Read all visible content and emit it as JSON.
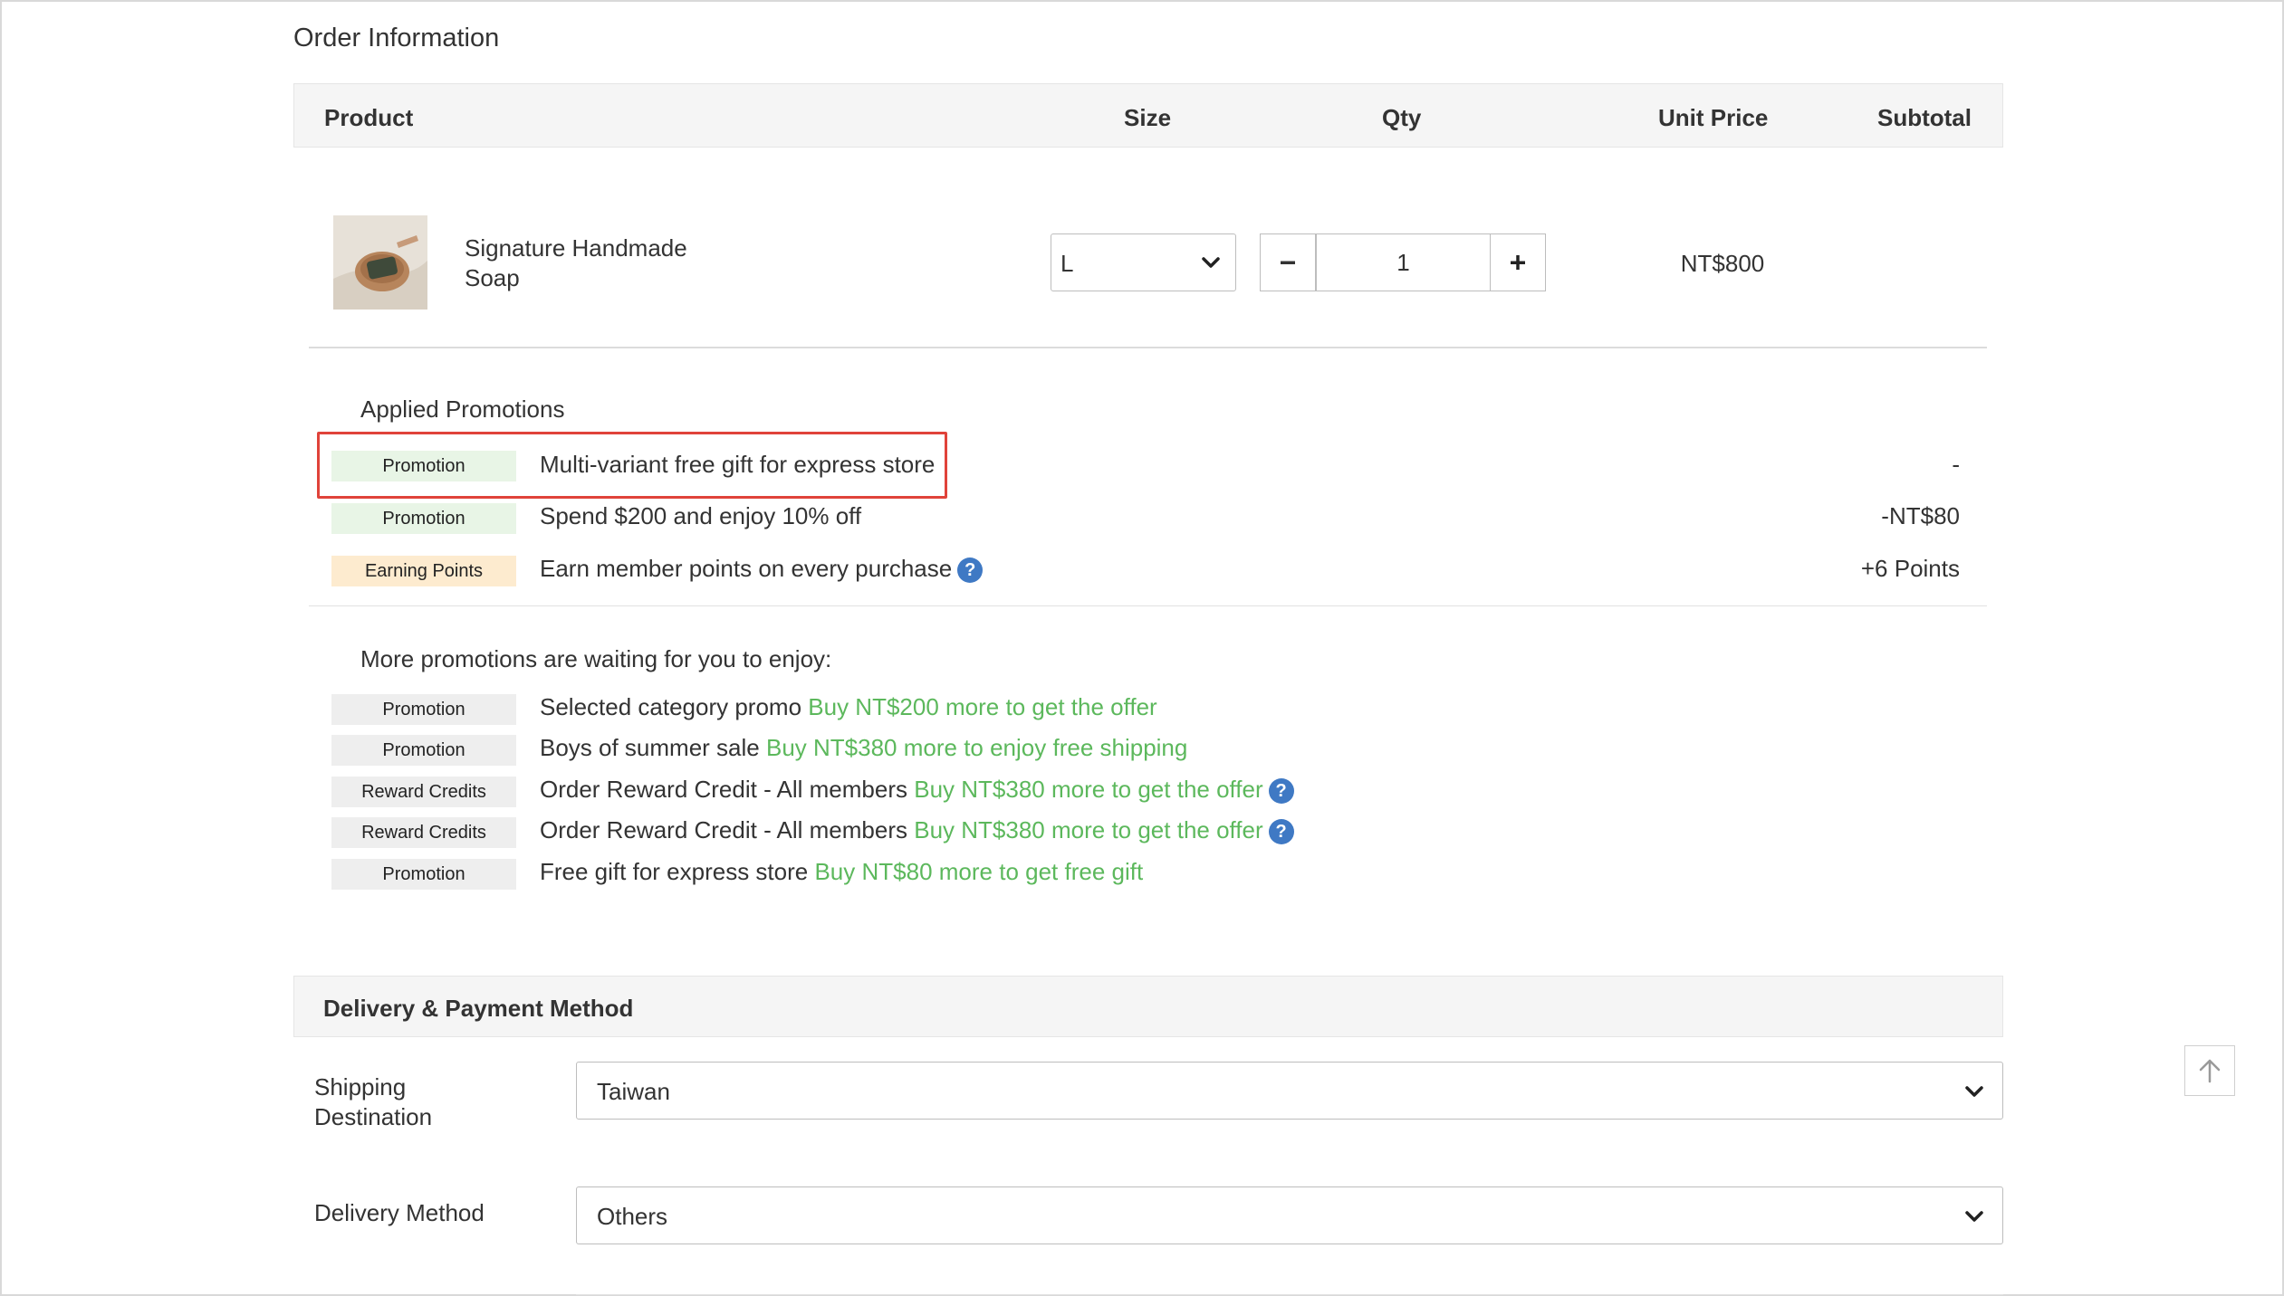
{
  "order_section": {
    "title": "Order Information",
    "columns": {
      "product": "Product",
      "size": "Size",
      "qty": "Qty",
      "unit_price": "Unit Price",
      "subtotal": "Subtotal"
    },
    "item": {
      "name": "Signature Handmade Soap",
      "size": "L",
      "qty": "1",
      "unit_price": "NT$800",
      "thumbnail": "soap-product-image"
    }
  },
  "applied_promotions": {
    "title": "Applied Promotions",
    "items": [
      {
        "tag": "Promotion",
        "tag_color": "#e8f5e6",
        "text": "Multi-variant free gift for express store",
        "value": "-"
      },
      {
        "tag": "Promotion",
        "tag_color": "#e8f5e6",
        "text": "Spend $200 and enjoy 10% off",
        "value": "-NT$80"
      },
      {
        "tag": "Earning Points",
        "tag_color": "#fdebcf",
        "text": "Earn member points on every purchase",
        "value": "+6 Points",
        "icon": "help-icon"
      }
    ]
  },
  "more_promotions": {
    "title": "More promotions are waiting for you to enjoy:",
    "items": [
      {
        "tag": "Promotion",
        "text": "Selected category promo",
        "hint": "Buy NT$200 more to get the offer"
      },
      {
        "tag": "Promotion",
        "text": "Boys of summer sale",
        "hint": "Buy NT$380 more to enjoy free shipping"
      },
      {
        "tag": "Reward Credits",
        "text": "Order Reward Credit - All members",
        "hint": "Buy NT$380 more to get the offer",
        "icon": "help-icon"
      },
      {
        "tag": "Reward Credits",
        "text": "Order Reward Credit - All members",
        "hint": "Buy NT$380 more to get the offer",
        "icon": "help-icon"
      },
      {
        "tag": "Promotion",
        "text": "Free gift for express store",
        "hint": "Buy NT$80 more to get free gift"
      }
    ]
  },
  "delivery": {
    "title": "Delivery & Payment Method",
    "shipping_label": "Shipping Destination",
    "shipping_value": "Taiwan",
    "method_label": "Delivery Method",
    "method_value": "Others"
  },
  "colors": {
    "hint_green": "#5cb85c",
    "highlight_red": "#e0433a",
    "help_blue": "#3f79c4"
  }
}
